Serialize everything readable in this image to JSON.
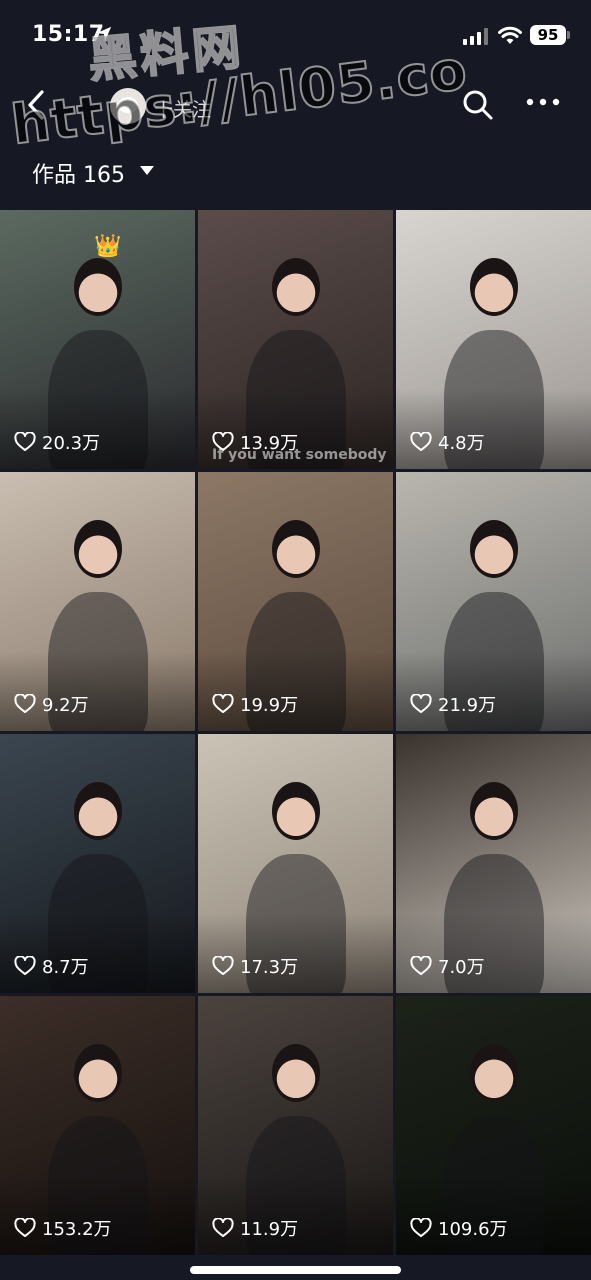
{
  "status_bar": {
    "time": "15:17",
    "battery": "95"
  },
  "header": {
    "follow_label": "十关注",
    "works_label": "作品 165"
  },
  "watermark": {
    "line1": "黑料网",
    "line2": "https://hl05.co"
  },
  "grid": [
    {
      "likes": "20.3万",
      "colors": [
        "#5b6a60",
        "#2a2a2e"
      ],
      "crown": "👑"
    },
    {
      "likes": "13.9万",
      "colors": [
        "#5a4c4a",
        "#2e2624"
      ],
      "caption": "If you want somebody"
    },
    {
      "likes": "4.8万",
      "colors": [
        "#d8d4cf",
        "#9b9692"
      ]
    },
    {
      "likes": "9.2万",
      "colors": [
        "#c9beb1",
        "#8a7a6b"
      ]
    },
    {
      "likes": "19.9万",
      "colors": [
        "#8d7866",
        "#5b4a3c"
      ]
    },
    {
      "likes": "21.9万",
      "colors": [
        "#b9b6ae",
        "#6d6f6e"
      ]
    },
    {
      "likes": "8.7万",
      "colors": [
        "#3b4650",
        "#15181c"
      ]
    },
    {
      "likes": "17.3万",
      "colors": [
        "#cbc3b6",
        "#8e8478"
      ]
    },
    {
      "likes": "7.0万",
      "colors": [
        "#3a322c",
        "#cfc9c2"
      ]
    },
    {
      "likes": "153.2万",
      "colors": [
        "#3c2e28",
        "#15100e"
      ]
    },
    {
      "likes": "11.9万",
      "colors": [
        "#4b433e",
        "#1a1716"
      ]
    },
    {
      "likes": "109.6万",
      "colors": [
        "#1c2319",
        "#0c0f0b"
      ]
    }
  ]
}
